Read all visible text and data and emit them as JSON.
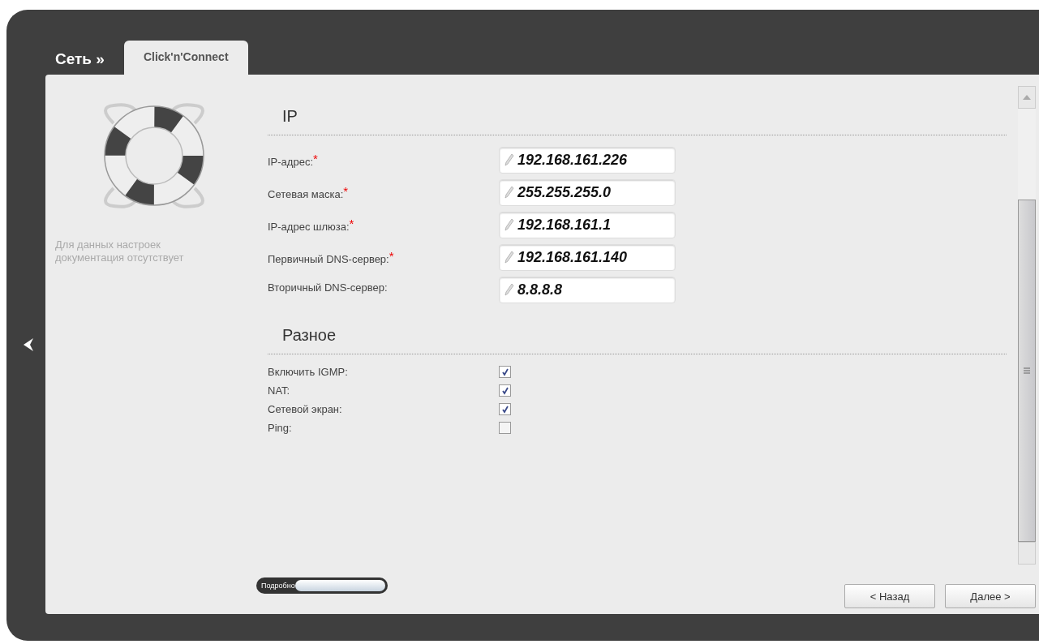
{
  "breadcrumb": {
    "section": "Сеть »"
  },
  "tabs": [
    {
      "label": "Click'n'Connect",
      "selected": true
    }
  ],
  "help": {
    "text": "Для данных настроек документация отсутствует"
  },
  "sections": [
    {
      "title": "IP",
      "fields": [
        {
          "kind": "text",
          "label": "IP-адрес:",
          "marker": "*",
          "value": "192.168.161.226"
        },
        {
          "kind": "text",
          "label": "Сетевая маска:",
          "marker": "*",
          "value": "255.255.255.0"
        },
        {
          "kind": "text",
          "label": "IP-адрес шлюза:",
          "marker": "*",
          "value": "192.168.161.1"
        },
        {
          "kind": "text",
          "label": "Первичный DNS-сервер:",
          "marker": "*",
          "value": "192.168.161.140"
        },
        {
          "kind": "text",
          "label": "Вторичный DNS-сервер:",
          "value": "8.8.8.8"
        }
      ]
    },
    {
      "title": "Разное",
      "fields": [
        {
          "kind": "checkbox",
          "label": "Включить IGMP:",
          "checked": true
        },
        {
          "kind": "checkbox",
          "label": "NAT:",
          "checked": true
        },
        {
          "kind": "checkbox",
          "label": "Сетевой экран:",
          "checked": true
        },
        {
          "kind": "checkbox",
          "label": "Ping:",
          "checked": false
        }
      ]
    }
  ],
  "details_toggle": {
    "label": "Подробно",
    "on": false
  },
  "buttons": [
    "< Назад",
    "Далее >"
  ]
}
